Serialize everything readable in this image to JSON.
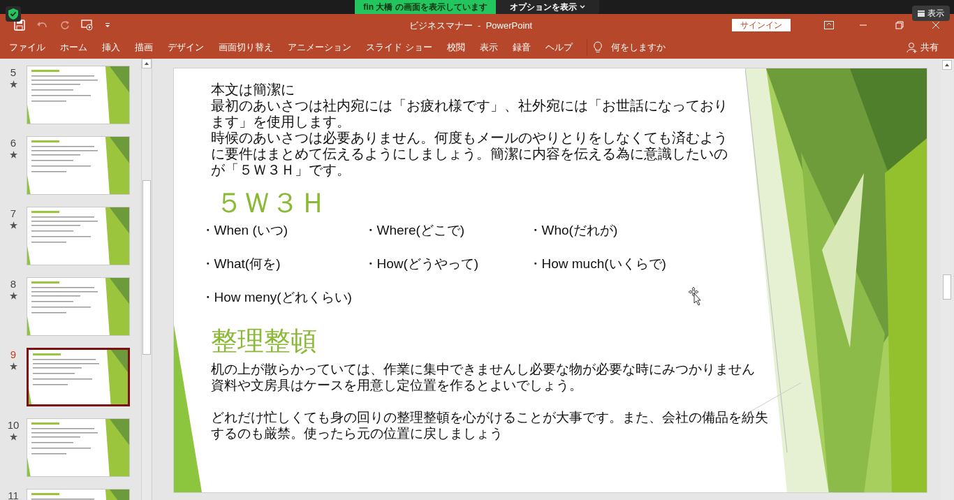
{
  "share_banner": {
    "presenter": "fin 大橋 の画面を表示しています",
    "options": "オプションを表示",
    "view": "表示"
  },
  "title_bar": {
    "document": "ビジネスマナー  -  PowerPoint",
    "sign_in": "サインイン"
  },
  "ribbon_tabs": [
    {
      "label": "ファイル",
      "selected": false
    },
    {
      "label": "ホーム",
      "selected": false
    },
    {
      "label": "挿入",
      "selected": false
    },
    {
      "label": "描画",
      "selected": false
    },
    {
      "label": "デザイン",
      "selected": false
    },
    {
      "label": "画面切り替え",
      "selected": false
    },
    {
      "label": "アニメーション",
      "selected": false
    },
    {
      "label": "スライド ショー",
      "selected": false
    },
    {
      "label": "校閲",
      "selected": false
    },
    {
      "label": "表示",
      "selected": false
    },
    {
      "label": "録音",
      "selected": false
    },
    {
      "label": "ヘルプ",
      "selected": false
    }
  ],
  "tell_me": "何をしますか",
  "share": "共有",
  "slides": [
    {
      "number": "5",
      "selected": false
    },
    {
      "number": "6",
      "selected": false
    },
    {
      "number": "7",
      "selected": false
    },
    {
      "number": "8",
      "selected": false
    },
    {
      "number": "9",
      "selected": true
    },
    {
      "number": "10",
      "selected": false
    },
    {
      "number": "11",
      "selected": false
    }
  ],
  "slide": {
    "intro": [
      "本文は簡潔に",
      "最初のあいさつは社内宛には「お疲れ様です」、社外宛には「お世話になっております」を使用します。",
      "時候のあいさつは必要ありません。何度もメールのやりとりをしなくても済むように要件はまとめて伝えるようにしましょう。簡潔に内容を伝える為に意識したいのが「５Ｗ３Ｈ」です。"
    ],
    "heading_1": "５Ｗ３Ｈ",
    "bullets": [
      "・When (いつ)",
      "・Where(どこで)",
      "・Who(だれが)",
      "・What(何を)",
      "・How(どうやって)",
      "・How much(いくらで)",
      "・How meny(どれくらい)"
    ],
    "heading_2": "整理整頓",
    "body": [
      [
        "机の上が散らかっていては、作業に集中できませんし必要な物が必要な時にみつかりません",
        "資料や文房具はケースを用意し定位置を作るとよいでしょう。"
      ],
      [
        "どれだけ忙しくても身の回りの整理整頓を心がけることが大事です。また、会社の備品を紛失",
        "するのも厳禁。使ったら元の位置に戻しましょう"
      ]
    ]
  }
}
